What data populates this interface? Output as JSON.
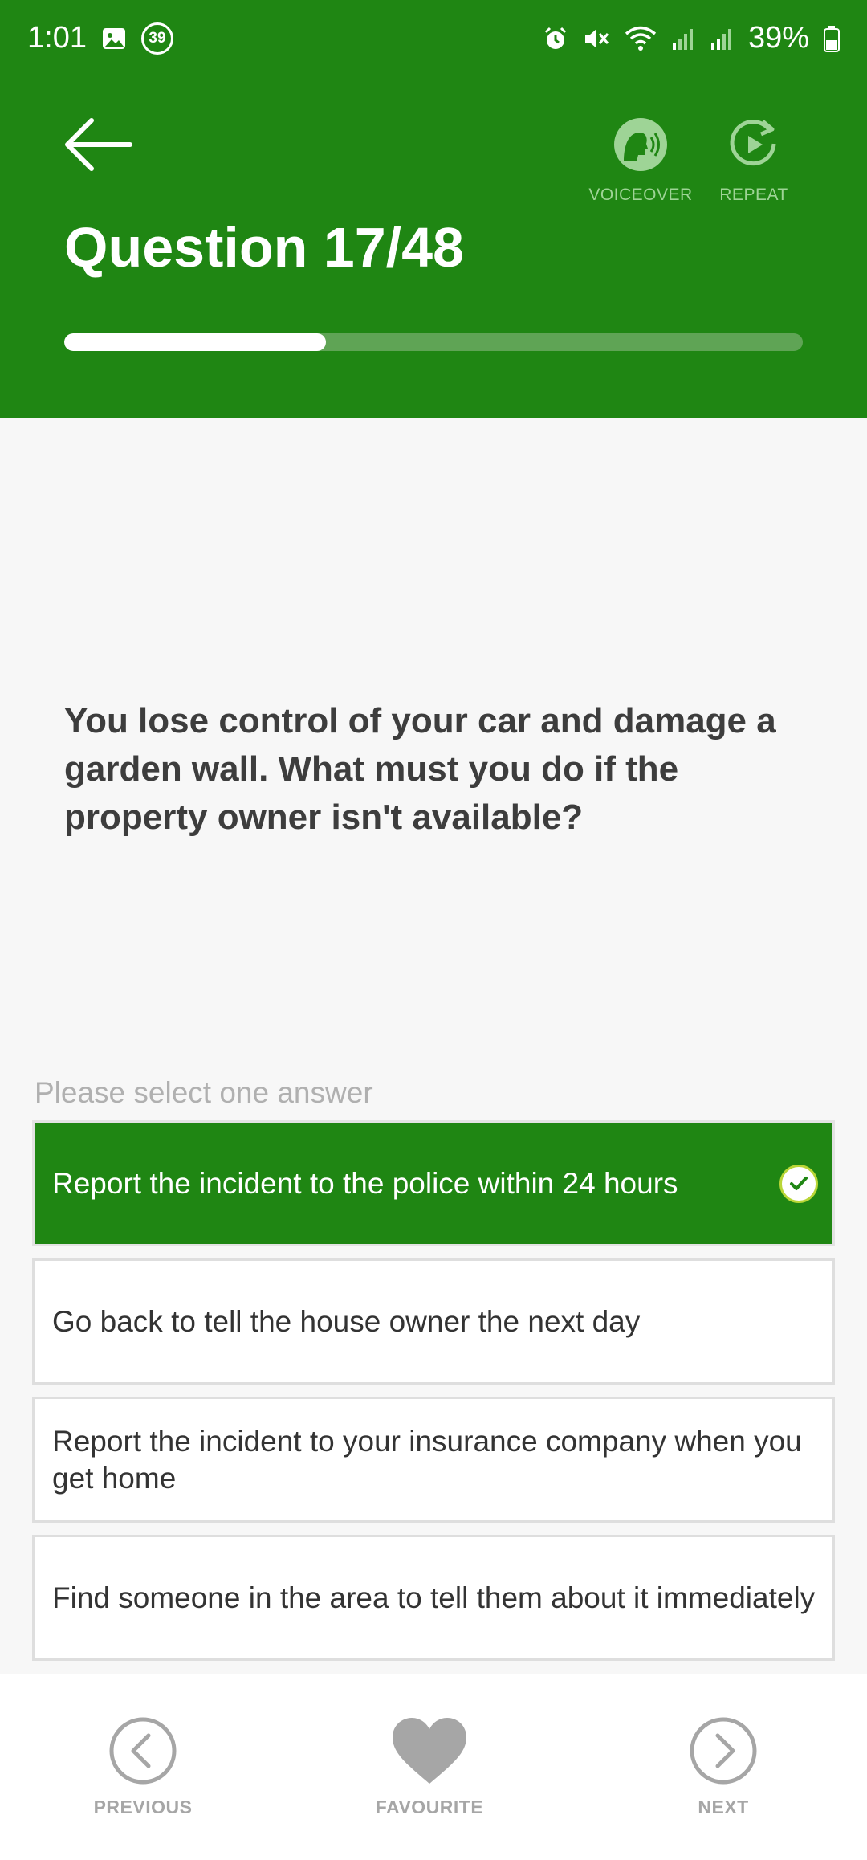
{
  "status_bar": {
    "time": "1:01",
    "notification_count": "39",
    "battery": "39%"
  },
  "header": {
    "title": "Question 17/48",
    "voiceover_label": "VOICEOVER",
    "repeat_label": "REPEAT",
    "progress_fraction": 0.354
  },
  "question": {
    "text": "You lose control of your car and damage a garden wall. What must you do if the property owner isn't available?"
  },
  "answers": {
    "prompt": "Please select one answer",
    "items": [
      {
        "text": "Report the incident to the police within 24 hours",
        "selected": true
      },
      {
        "text": "Go back to tell the house owner the next day",
        "selected": false
      },
      {
        "text": "Report the incident to your insurance company when you get home",
        "selected": false
      },
      {
        "text": "Find someone in the area to tell them about it immediately",
        "selected": false
      }
    ]
  },
  "bottom_nav": {
    "previous_label": "PREVIOUS",
    "favourite_label": "FAVOURITE",
    "next_label": "NEXT"
  },
  "colors": {
    "brand_green": "#1f8613",
    "progress_track": "#5fa455",
    "nav_gray": "#a6a6a6"
  }
}
